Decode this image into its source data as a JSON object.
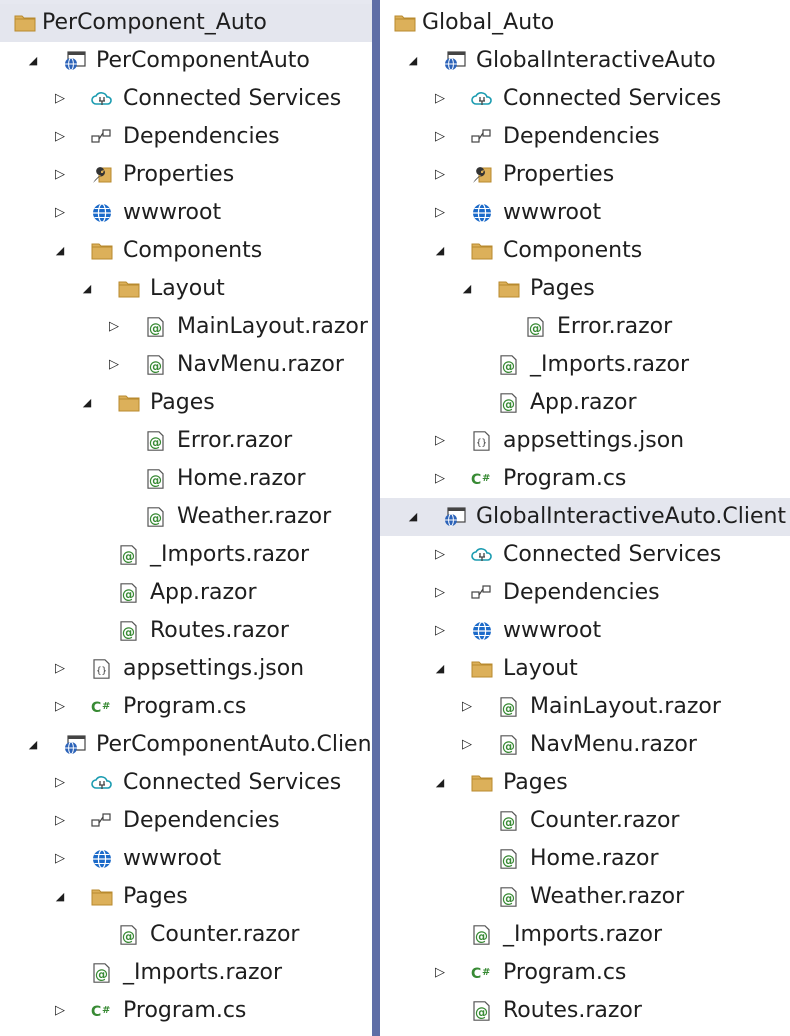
{
  "left": {
    "rows": [
      {
        "label": "PerComponent_Auto",
        "icon": "solution-folder-icon",
        "depth": 0,
        "arrow": "none",
        "selected": true
      },
      {
        "label": "PerComponentAuto",
        "icon": "web-project-icon",
        "depth": 0,
        "arrow": "expanded"
      },
      {
        "label": "Connected Services",
        "icon": "connected-services-icon",
        "depth": 1,
        "arrow": "collapsed"
      },
      {
        "label": "Dependencies",
        "icon": "dependencies-icon",
        "depth": 1,
        "arrow": "collapsed"
      },
      {
        "label": "Properties",
        "icon": "properties-wrench-icon",
        "depth": 1,
        "arrow": "collapsed"
      },
      {
        "label": "wwwroot",
        "icon": "globe-icon",
        "depth": 1,
        "arrow": "collapsed"
      },
      {
        "label": "Components",
        "icon": "folder-icon",
        "depth": 1,
        "arrow": "expanded"
      },
      {
        "label": "Layout",
        "icon": "folder-icon",
        "depth": 2,
        "arrow": "expanded"
      },
      {
        "label": "MainLayout.razor",
        "icon": "razor-file-icon",
        "depth": 3,
        "arrow": "collapsed"
      },
      {
        "label": "NavMenu.razor",
        "icon": "razor-file-icon",
        "depth": 3,
        "arrow": "collapsed"
      },
      {
        "label": "Pages",
        "icon": "folder-icon",
        "depth": 2,
        "arrow": "expanded"
      },
      {
        "label": "Error.razor",
        "icon": "razor-file-icon",
        "depth": 3,
        "arrow": "none"
      },
      {
        "label": "Home.razor",
        "icon": "razor-file-icon",
        "depth": 3,
        "arrow": "none"
      },
      {
        "label": "Weather.razor",
        "icon": "razor-file-icon",
        "depth": 3,
        "arrow": "none"
      },
      {
        "label": "_Imports.razor",
        "icon": "razor-file-icon",
        "depth": 2,
        "arrow": "none"
      },
      {
        "label": "App.razor",
        "icon": "razor-file-icon",
        "depth": 2,
        "arrow": "none"
      },
      {
        "label": "Routes.razor",
        "icon": "razor-file-icon",
        "depth": 2,
        "arrow": "none"
      },
      {
        "label": "appsettings.json",
        "icon": "json-file-icon",
        "depth": 1,
        "arrow": "collapsed"
      },
      {
        "label": "Program.cs",
        "icon": "csharp-file-icon",
        "depth": 1,
        "arrow": "collapsed"
      },
      {
        "label": "PerComponentAuto.Client",
        "icon": "web-project-icon",
        "depth": 0,
        "arrow": "expanded"
      },
      {
        "label": "Connected Services",
        "icon": "connected-services-icon",
        "depth": 1,
        "arrow": "collapsed"
      },
      {
        "label": "Dependencies",
        "icon": "dependencies-icon",
        "depth": 1,
        "arrow": "collapsed"
      },
      {
        "label": "wwwroot",
        "icon": "globe-icon",
        "depth": 1,
        "arrow": "collapsed"
      },
      {
        "label": "Pages",
        "icon": "folder-icon",
        "depth": 1,
        "arrow": "expanded"
      },
      {
        "label": "Counter.razor",
        "icon": "razor-file-icon",
        "depth": 2,
        "arrow": "none"
      },
      {
        "label": "_Imports.razor",
        "icon": "razor-file-icon",
        "depth": 1,
        "arrow": "none"
      },
      {
        "label": "Program.cs",
        "icon": "csharp-file-icon",
        "depth": 1,
        "arrow": "collapsed"
      }
    ]
  },
  "right": {
    "rows": [
      {
        "label": "Global_Auto",
        "icon": "solution-folder-icon",
        "depth": 0,
        "arrow": "none"
      },
      {
        "label": "GlobalInteractiveAuto",
        "icon": "web-project-icon",
        "depth": 0,
        "arrow": "expanded"
      },
      {
        "label": "Connected Services",
        "icon": "connected-services-icon",
        "depth": 1,
        "arrow": "collapsed"
      },
      {
        "label": "Dependencies",
        "icon": "dependencies-icon",
        "depth": 1,
        "arrow": "collapsed"
      },
      {
        "label": "Properties",
        "icon": "properties-wrench-icon",
        "depth": 1,
        "arrow": "collapsed"
      },
      {
        "label": "wwwroot",
        "icon": "globe-icon",
        "depth": 1,
        "arrow": "collapsed"
      },
      {
        "label": "Components",
        "icon": "folder-icon",
        "depth": 1,
        "arrow": "expanded"
      },
      {
        "label": "Pages",
        "icon": "folder-icon",
        "depth": 2,
        "arrow": "expanded"
      },
      {
        "label": "Error.razor",
        "icon": "razor-file-icon",
        "depth": 3,
        "arrow": "none"
      },
      {
        "label": "_Imports.razor",
        "icon": "razor-file-icon",
        "depth": 2,
        "arrow": "none"
      },
      {
        "label": "App.razor",
        "icon": "razor-file-icon",
        "depth": 2,
        "arrow": "none"
      },
      {
        "label": "appsettings.json",
        "icon": "json-file-icon",
        "depth": 1,
        "arrow": "collapsed"
      },
      {
        "label": "Program.cs",
        "icon": "csharp-file-icon",
        "depth": 1,
        "arrow": "collapsed"
      },
      {
        "label": "GlobalInteractiveAuto.Client",
        "icon": "web-project-icon",
        "depth": 0,
        "arrow": "expanded",
        "selected": true
      },
      {
        "label": "Connected Services",
        "icon": "connected-services-icon",
        "depth": 1,
        "arrow": "collapsed"
      },
      {
        "label": "Dependencies",
        "icon": "dependencies-icon",
        "depth": 1,
        "arrow": "collapsed"
      },
      {
        "label": "wwwroot",
        "icon": "globe-icon",
        "depth": 1,
        "arrow": "collapsed"
      },
      {
        "label": "Layout",
        "icon": "folder-icon",
        "depth": 1,
        "arrow": "expanded"
      },
      {
        "label": "MainLayout.razor",
        "icon": "razor-file-icon",
        "depth": 2,
        "arrow": "collapsed"
      },
      {
        "label": "NavMenu.razor",
        "icon": "razor-file-icon",
        "depth": 2,
        "arrow": "collapsed"
      },
      {
        "label": "Pages",
        "icon": "folder-icon",
        "depth": 1,
        "arrow": "expanded"
      },
      {
        "label": "Counter.razor",
        "icon": "razor-file-icon",
        "depth": 2,
        "arrow": "none"
      },
      {
        "label": "Home.razor",
        "icon": "razor-file-icon",
        "depth": 2,
        "arrow": "none"
      },
      {
        "label": "Weather.razor",
        "icon": "razor-file-icon",
        "depth": 2,
        "arrow": "none"
      },
      {
        "label": "_Imports.razor",
        "icon": "razor-file-icon",
        "depth": 1,
        "arrow": "none"
      },
      {
        "label": "Program.cs",
        "icon": "csharp-file-icon",
        "depth": 1,
        "arrow": "collapsed"
      },
      {
        "label": "Routes.razor",
        "icon": "razor-file-icon",
        "depth": 1,
        "arrow": "none"
      }
    ]
  },
  "colors": {
    "folder": "#dcb05a",
    "folder_dark": "#b88a2e",
    "razor_green": "#388a34",
    "globe_blue": "#1b6ac9",
    "project_blue": "#2b62b8",
    "cloud_teal": "#1a9bb0",
    "splitter": "#5f6ea6",
    "selection": "#e4e6ee"
  }
}
